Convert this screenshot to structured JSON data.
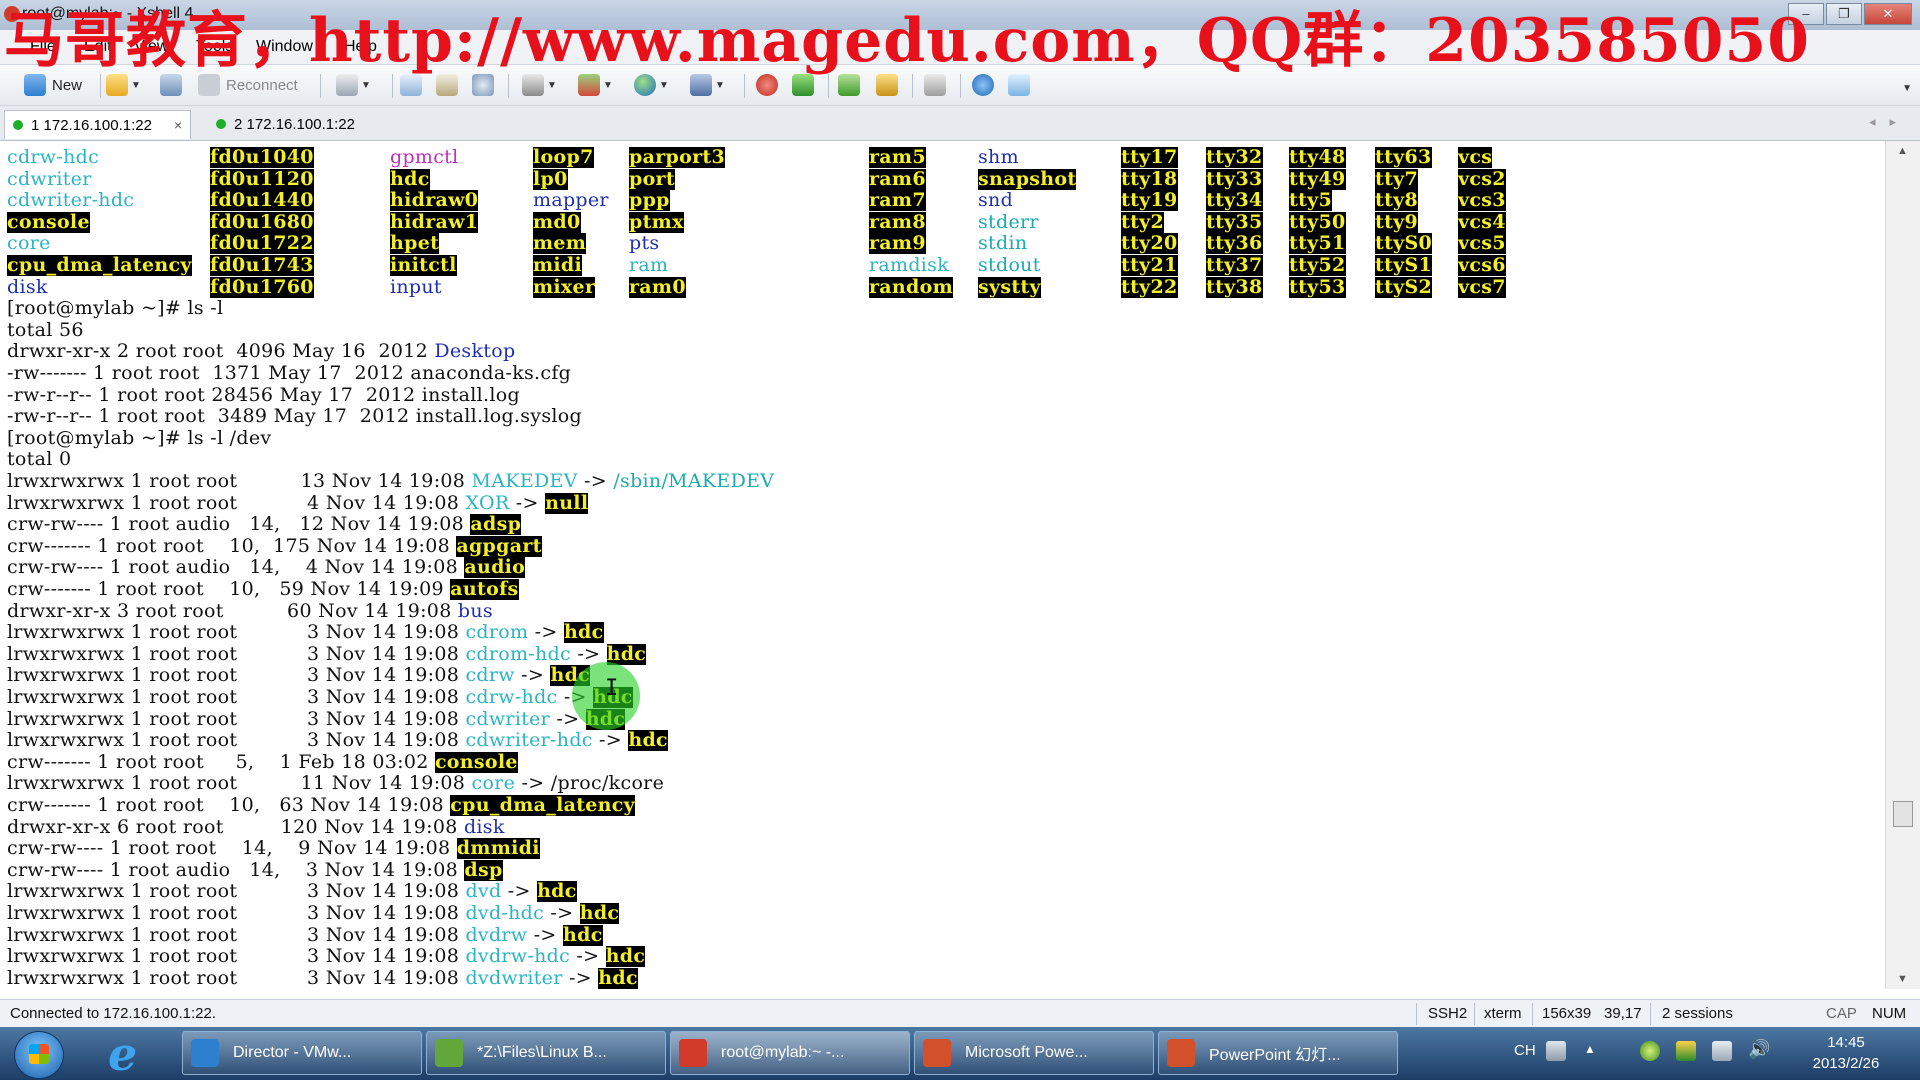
{
  "window": {
    "title": "root@mylab:~ - Xshell 4",
    "watermark": "马哥教育，http://www.magedu.com，QQ群：203585050",
    "controls": {
      "minimize": "–",
      "restore": "❐",
      "close": "✕"
    }
  },
  "menu": [
    "File",
    "Edit",
    "View",
    "Tools",
    "Window",
    "Help"
  ],
  "toolbar": {
    "new_label": "New",
    "reconnect_label": "Reconnect"
  },
  "tabs": [
    {
      "label": "1 172.16.100.1:22",
      "active": true,
      "close": "×"
    },
    {
      "label": "2 172.16.100.1:22",
      "active": false
    }
  ],
  "terminal": {
    "colors": {
      "cyan": "#2ab4c4",
      "blue": "#1e2fb0",
      "magenta": "#c22cc4",
      "highlight_fg": "#f2ee2a",
      "highlight_bg": "#000000"
    },
    "grid": [
      [
        [
          "cdrw-hdc",
          "cyan"
        ],
        [
          "fd0u1040",
          "yb"
        ],
        [
          "gpmctl",
          "magenta"
        ],
        [
          "loop7",
          "yb"
        ],
        [
          "parport3",
          "yb"
        ],
        [
          "ram5",
          "yb"
        ],
        [
          "shm",
          "blue"
        ],
        [
          "tty17",
          "yb"
        ],
        [
          "tty32",
          "yb"
        ],
        [
          "tty48",
          "yb"
        ],
        [
          "tty63",
          "yb"
        ],
        [
          "vcs",
          "yb"
        ]
      ],
      [
        [
          "cdwriter",
          "cyan"
        ],
        [
          "fd0u1120",
          "yb"
        ],
        [
          "hdc",
          "yb"
        ],
        [
          "lp0",
          "yb"
        ],
        [
          "port",
          "yb"
        ],
        [
          "ram6",
          "yb"
        ],
        [
          "snapshot",
          "yb"
        ],
        [
          "tty18",
          "yb"
        ],
        [
          "tty33",
          "yb"
        ],
        [
          "tty49",
          "yb"
        ],
        [
          "tty7",
          "yb"
        ],
        [
          "vcs2",
          "yb"
        ]
      ],
      [
        [
          "cdwriter-hdc",
          "cyan"
        ],
        [
          "fd0u1440",
          "yb"
        ],
        [
          "hidraw0",
          "yb"
        ],
        [
          "mapper",
          "blue"
        ],
        [
          "ppp",
          "yb"
        ],
        [
          "ram7",
          "yb"
        ],
        [
          "snd",
          "blue"
        ],
        [
          "tty19",
          "yb"
        ],
        [
          "tty34",
          "yb"
        ],
        [
          "tty5",
          "yb"
        ],
        [
          "tty8",
          "yb"
        ],
        [
          "vcs3",
          "yb"
        ]
      ],
      [
        [
          "console",
          "yb"
        ],
        [
          "fd0u1680",
          "yb"
        ],
        [
          "hidraw1",
          "yb"
        ],
        [
          "md0",
          "yb"
        ],
        [
          "ptmx",
          "yb"
        ],
        [
          "ram8",
          "yb"
        ],
        [
          "stderr",
          "teal"
        ],
        [
          "tty2",
          "yb"
        ],
        [
          "tty35",
          "yb"
        ],
        [
          "tty50",
          "yb"
        ],
        [
          "tty9",
          "yb"
        ],
        [
          "vcs4",
          "yb"
        ]
      ],
      [
        [
          "core",
          "cyan"
        ],
        [
          "fd0u1722",
          "yb"
        ],
        [
          "hpet",
          "yb"
        ],
        [
          "mem",
          "yb"
        ],
        [
          "pts",
          "blue"
        ],
        [
          "ram9",
          "yb"
        ],
        [
          "stdin",
          "teal"
        ],
        [
          "tty20",
          "yb"
        ],
        [
          "tty36",
          "yb"
        ],
        [
          "tty51",
          "yb"
        ],
        [
          "ttyS0",
          "yb"
        ],
        [
          "vcs5",
          "yb"
        ]
      ],
      [
        [
          "cpu_dma_latency",
          "yb"
        ],
        [
          "fd0u1743",
          "yb"
        ],
        [
          "initctl",
          "yb"
        ],
        [
          "midi",
          "yb"
        ],
        [
          "ram",
          "cyan"
        ],
        [
          "ramdisk",
          "cyan"
        ],
        [
          "stdout",
          "teal"
        ],
        [
          "tty21",
          "yb"
        ],
        [
          "tty37",
          "yb"
        ],
        [
          "tty52",
          "yb"
        ],
        [
          "ttyS1",
          "yb"
        ],
        [
          "vcs6",
          "yb"
        ]
      ],
      [
        [
          "disk",
          "blue"
        ],
        [
          "fd0u1760",
          "yb"
        ],
        [
          "input",
          "blue"
        ],
        [
          "mixer",
          "yb"
        ],
        [
          "ram0",
          "yb"
        ],
        [
          "random",
          "yb"
        ],
        [
          "systty",
          "yb"
        ],
        [
          "tty22",
          "yb"
        ],
        [
          "tty38",
          "yb"
        ],
        [
          "tty53",
          "yb"
        ],
        [
          "ttyS2",
          "yb"
        ],
        [
          "vcs7",
          "yb"
        ]
      ]
    ],
    "lines": [
      [
        [
          "[root@mylab ~]# ls -l",
          "none"
        ]
      ],
      [
        [
          "total 56",
          "none"
        ]
      ],
      [
        [
          "drwxr-xr-x 2 root root  4096 May 16  2012 ",
          "none"
        ],
        [
          "Desktop",
          "blue"
        ]
      ],
      [
        [
          "-rw------- 1 root root  1371 May 17  2012 anaconda-ks.cfg",
          "none"
        ]
      ],
      [
        [
          "-rw-r--r-- 1 root root 28456 May 17  2012 install.log",
          "none"
        ]
      ],
      [
        [
          "-rw-r--r-- 1 root root  3489 May 17  2012 install.log.syslog",
          "none"
        ]
      ],
      [
        [
          "[root@mylab ~]# ls -l /dev",
          "none"
        ]
      ],
      [
        [
          "total 0",
          "none"
        ]
      ],
      [
        [
          "lrwxrwxrwx 1 root root          13 Nov 14 19:08 ",
          "none"
        ],
        [
          "MAKEDEV",
          "cyan"
        ],
        [
          " -> ",
          "none"
        ],
        [
          "/sbin/MAKEDEV",
          "teal"
        ]
      ],
      [
        [
          "lrwxrwxrwx 1 root root           4 Nov 14 19:08 ",
          "none"
        ],
        [
          "XOR",
          "cyan"
        ],
        [
          " -> ",
          "none"
        ],
        [
          "null",
          "yb"
        ]
      ],
      [
        [
          "crw-rw---- 1 root audio   14,   12 Nov 14 19:08 ",
          "none"
        ],
        [
          "adsp",
          "yb"
        ]
      ],
      [
        [
          "crw------- 1 root root    10,  175 Nov 14 19:08 ",
          "none"
        ],
        [
          "agpgart",
          "yb"
        ]
      ],
      [
        [
          "crw-rw---- 1 root audio   14,    4 Nov 14 19:08 ",
          "none"
        ],
        [
          "audio",
          "yb"
        ]
      ],
      [
        [
          "crw------- 1 root root    10,   59 Nov 14 19:09 ",
          "none"
        ],
        [
          "autofs",
          "yb"
        ]
      ],
      [
        [
          "drwxr-xr-x 3 root root          60 Nov 14 19:08 ",
          "none"
        ],
        [
          "bus",
          "blue"
        ]
      ],
      [
        [
          "lrwxrwxrwx 1 root root           3 Nov 14 19:08 ",
          "none"
        ],
        [
          "cdrom",
          "cyan"
        ],
        [
          " -> ",
          "none"
        ],
        [
          "hdc",
          "yb"
        ]
      ],
      [
        [
          "lrwxrwxrwx 1 root root           3 Nov 14 19:08 ",
          "none"
        ],
        [
          "cdrom-hdc",
          "cyan"
        ],
        [
          " -> ",
          "none"
        ],
        [
          "hdc",
          "yb"
        ]
      ],
      [
        [
          "lrwxrwxrwx 1 root root           3 Nov 14 19:08 ",
          "none"
        ],
        [
          "cdrw",
          "cyan"
        ],
        [
          " -> ",
          "none"
        ],
        [
          "hdc",
          "yb"
        ]
      ],
      [
        [
          "lrwxrwxrwx 1 root root           3 Nov 14 19:08 ",
          "none"
        ],
        [
          "cdrw-hdc",
          "cyan"
        ],
        [
          " -> ",
          "none"
        ],
        [
          "hdc",
          "yb"
        ]
      ],
      [
        [
          "lrwxrwxrwx 1 root root           3 Nov 14 19:08 ",
          "none"
        ],
        [
          "cdwriter",
          "cyan"
        ],
        [
          " -> ",
          "none"
        ],
        [
          "hdc",
          "yb"
        ]
      ],
      [
        [
          "lrwxrwxrwx 1 root root           3 Nov 14 19:08 ",
          "none"
        ],
        [
          "cdwriter-hdc",
          "cyan"
        ],
        [
          " -> ",
          "none"
        ],
        [
          "hdc",
          "yb"
        ]
      ],
      [
        [
          "crw------- 1 root root     5,    1 Feb 18 03:02 ",
          "none"
        ],
        [
          "console",
          "yb"
        ]
      ],
      [
        [
          "lrwxrwxrwx 1 root root          11 Nov 14 19:08 ",
          "none"
        ],
        [
          "core",
          "cyan"
        ],
        [
          " -> /proc/kcore",
          "none"
        ]
      ],
      [
        [
          "crw------- 1 root root    10,   63 Nov 14 19:08 ",
          "none"
        ],
        [
          "cpu_dma_latency",
          "yb"
        ]
      ],
      [
        [
          "drwxr-xr-x 6 root root         120 Nov 14 19:08 ",
          "none"
        ],
        [
          "disk",
          "blue"
        ]
      ],
      [
        [
          "crw-rw---- 1 root root    14,    9 Nov 14 19:08 ",
          "none"
        ],
        [
          "dmmidi",
          "yb"
        ]
      ],
      [
        [
          "crw-rw---- 1 root audio   14,    3 Nov 14 19:08 ",
          "none"
        ],
        [
          "dsp",
          "yb"
        ]
      ],
      [
        [
          "lrwxrwxrwx 1 root root           3 Nov 14 19:08 ",
          "none"
        ],
        [
          "dvd",
          "cyan"
        ],
        [
          " -> ",
          "none"
        ],
        [
          "hdc",
          "yb"
        ]
      ],
      [
        [
          "lrwxrwxrwx 1 root root           3 Nov 14 19:08 ",
          "none"
        ],
        [
          "dvd-hdc",
          "cyan"
        ],
        [
          " -> ",
          "none"
        ],
        [
          "hdc",
          "yb"
        ]
      ],
      [
        [
          "lrwxrwxrwx 1 root root           3 Nov 14 19:08 ",
          "none"
        ],
        [
          "dvdrw",
          "cyan"
        ],
        [
          " -> ",
          "none"
        ],
        [
          "hdc",
          "yb"
        ]
      ],
      [
        [
          "lrwxrwxrwx 1 root root           3 Nov 14 19:08 ",
          "none"
        ],
        [
          "dvdrw-hdc",
          "cyan"
        ],
        [
          " -> ",
          "none"
        ],
        [
          "hdc",
          "yb"
        ]
      ],
      [
        [
          "lrwxrwxrwx 1 root root           3 Nov 14 19:08 ",
          "none"
        ],
        [
          "dvdwriter",
          "cyan"
        ],
        [
          " -> ",
          "none"
        ],
        [
          "hdc",
          "yb"
        ]
      ]
    ]
  },
  "statusbar": {
    "connection": "Connected to 172.16.100.1:22.",
    "protocol": "SSH2",
    "term": "xterm",
    "size": "156x39",
    "cursor": "39,17",
    "sessions": "2 sessions",
    "caps": "CAP",
    "num": "NUM"
  },
  "taskbar": {
    "items": [
      {
        "label": "Director - VMw...",
        "icon": "vmware-icon",
        "color": "#2f7fd0"
      },
      {
        "label": "*Z:\\Files\\Linux B...",
        "icon": "notepad-icon",
        "color": "#63a63a"
      },
      {
        "label": "root@mylab:~ -...",
        "icon": "xshell-icon",
        "color": "#d23a2a"
      },
      {
        "label": "Microsoft Powe...",
        "icon": "powerpoint-icon",
        "color": "#d2502a"
      },
      {
        "label": "PowerPoint 幻灯...",
        "icon": "powerpoint-slideshow-icon",
        "color": "#d2502a"
      }
    ],
    "lang": "CH",
    "time": "14:45",
    "date": "2013/2/26"
  }
}
